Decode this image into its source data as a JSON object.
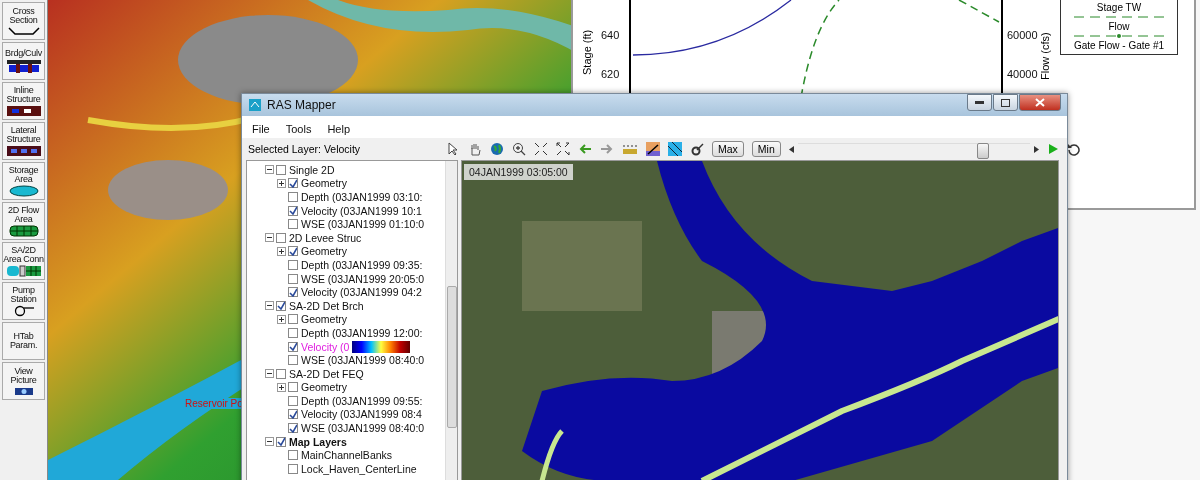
{
  "tool_palette": [
    {
      "label": "Cross Section",
      "kind": "cross-section"
    },
    {
      "label": "Brdg/Culv",
      "kind": "bridge"
    },
    {
      "label": "Inline Structure",
      "kind": "inline"
    },
    {
      "label": "Lateral Structure",
      "kind": "lateral"
    },
    {
      "label": "Storage Area",
      "kind": "storage"
    },
    {
      "label": "2D Flow Area",
      "kind": "flow2d"
    },
    {
      "label": "SA/2D Area Conn",
      "kind": "conn"
    },
    {
      "label": "Pump Station",
      "kind": "pump"
    },
    {
      "label": "HTab Param.",
      "kind": "none"
    },
    {
      "label": "View Picture",
      "kind": "camera"
    }
  ],
  "terrain_map": {
    "label": "Reservoir Po"
  },
  "plot_window": {
    "left_axis": {
      "label": "Stage (ft)",
      "ticks": [
        "640",
        "620"
      ]
    },
    "right_axis": {
      "label": "Flow (cfs)",
      "ticks": [
        "60000",
        "40000"
      ]
    },
    "legend": [
      {
        "label": "Stage TW",
        "kind": "dash"
      },
      {
        "label": "Flow",
        "kind": "dash-marker"
      },
      {
        "label": "Gate Flow - Gate #1",
        "kind": "none"
      }
    ]
  },
  "ras_mapper": {
    "title": "RAS Mapper",
    "menu": [
      "File",
      "Tools",
      "Help"
    ],
    "selected_layer": "Selected Layer: Velocity",
    "tree": [
      {
        "label": "Single 2D",
        "kind": "result",
        "checked": false,
        "expanded": true,
        "selected": false,
        "children": [
          {
            "label": "Geometry",
            "checked": true,
            "expanded": false,
            "selected": false
          },
          {
            "label": "Depth (03JAN1999 03:10:",
            "checked": false,
            "selected": false
          },
          {
            "label": "Velocity (03JAN1999 10:1",
            "checked": true,
            "selected": false
          },
          {
            "label": "WSE (03JAN1999 01:10:0",
            "checked": false,
            "selected": false
          }
        ]
      },
      {
        "label": "2D Levee Struc",
        "kind": "result",
        "checked": false,
        "expanded": true,
        "selected": false,
        "children": [
          {
            "label": "Geometry",
            "checked": true,
            "expanded": false,
            "selected": false
          },
          {
            "label": "Depth (03JAN1999 09:35:",
            "checked": false,
            "selected": false
          },
          {
            "label": "WSE (03JAN1999 20:05:0",
            "checked": false,
            "selected": false
          },
          {
            "label": "Velocity (03JAN1999 04:2",
            "checked": true,
            "selected": false
          }
        ]
      },
      {
        "label": "SA-2D Det Brch",
        "kind": "result",
        "checked": true,
        "expanded": true,
        "selected": false,
        "children": [
          {
            "label": "Geometry",
            "checked": false,
            "expanded": false,
            "selected": false
          },
          {
            "label": "Depth (03JAN1999 12:00:",
            "checked": false,
            "selected": false
          },
          {
            "label": "Velocity (0",
            "checked": true,
            "selected": true
          },
          {
            "label": "WSE (03JAN1999 08:40:0",
            "checked": false,
            "selected": false
          }
        ]
      },
      {
        "label": "SA-2D Det FEQ",
        "kind": "result",
        "checked": false,
        "expanded": true,
        "selected": false,
        "children": [
          {
            "label": "Geometry",
            "checked": false,
            "expanded": false,
            "selected": false
          },
          {
            "label": "Depth (03JAN1999 09:55:",
            "checked": false,
            "selected": false
          },
          {
            "label": "Velocity (03JAN1999 08:4",
            "checked": true,
            "selected": false
          },
          {
            "label": "WSE (03JAN1999 08:40:0",
            "checked": true,
            "selected": false
          }
        ]
      },
      {
        "label": "Map Layers",
        "kind": "group",
        "checked": true,
        "expanded": true,
        "selected": false,
        "children": [
          {
            "label": "MainChannelBanks",
            "checked": false,
            "selected": false
          },
          {
            "label": "Lock_Haven_CenterLine",
            "checked": false,
            "selected": false
          }
        ]
      }
    ],
    "buttons": [
      "Max",
      "Min"
    ],
    "time_slider": {
      "level": 0.8
    },
    "map": {
      "timestamp": "04JAN1999 03:05:00"
    }
  }
}
